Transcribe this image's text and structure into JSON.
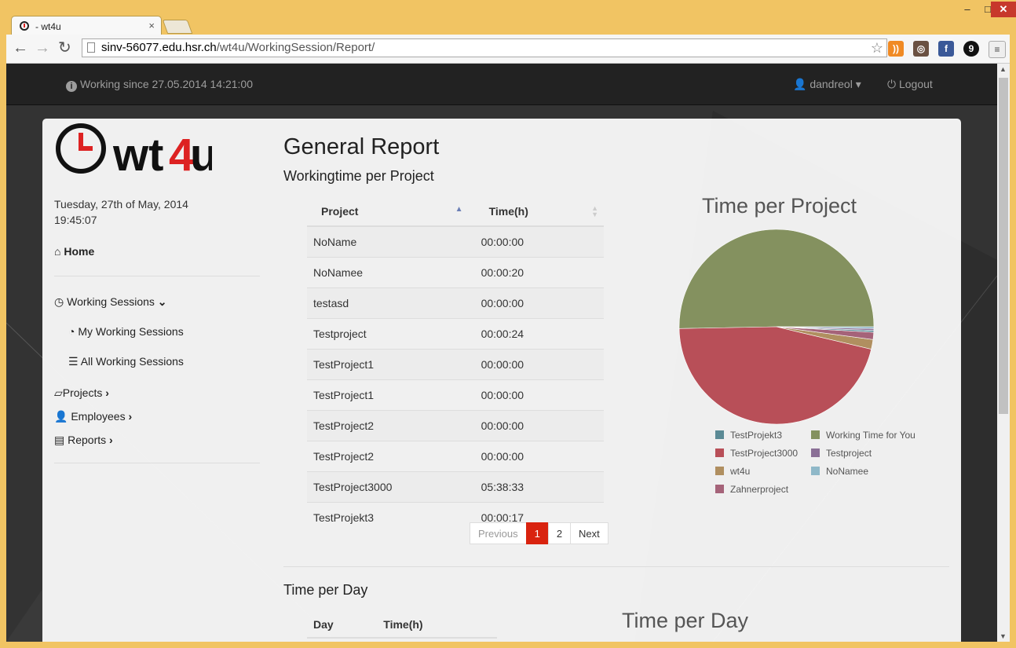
{
  "browser": {
    "tab_title": "- wt4u",
    "tab_close": "×",
    "url_host": "sinv-56077.edu.hsr.ch",
    "url_path": "/wt4u/WorkingSession/Report/",
    "window_controls": [
      "–",
      "□",
      "✕"
    ],
    "extensions": [
      "rss-icon",
      "instagram-icon",
      "facebook-icon",
      "nine-icon",
      "menu-icon"
    ]
  },
  "topnav": {
    "info_text": "Working since 27.05.2014 14:21:00",
    "user": "dandreol",
    "logout": "Logout"
  },
  "sidebar": {
    "logo_text_a": "wt",
    "logo_text_b": "4",
    "logo_text_c": "u",
    "date_line1": "Tuesday, 27th of May, 2014",
    "date_line2": "19:45:07",
    "home": "Home",
    "working_sessions": "Working Sessions",
    "my_working_sessions": "My Working Sessions",
    "all_working_sessions": "All Working Sessions",
    "projects": "Projects",
    "employees": "Employees",
    "reports": "Reports"
  },
  "main": {
    "title": "General Report",
    "section1": "Workingtime per Project",
    "section2": "Time per Day",
    "project_table": {
      "headers": [
        "Project",
        "Time(h)"
      ],
      "rows": [
        [
          "NoName",
          "00:00:00"
        ],
        [
          "NoNamee",
          "00:00:20"
        ],
        [
          "testasd",
          "00:00:00"
        ],
        [
          "Testproject",
          "00:00:24"
        ],
        [
          "TestProject1",
          "00:00:00"
        ],
        [
          "TestProject1",
          "00:00:00"
        ],
        [
          "TestProject2",
          "00:00:00"
        ],
        [
          "TestProject2",
          "00:00:00"
        ],
        [
          "TestProject3000",
          "05:38:33"
        ],
        [
          "TestProjekt3",
          "00:00:17"
        ]
      ]
    },
    "pager": {
      "previous": "Previous",
      "page1": "1",
      "page2": "2",
      "next": "Next"
    },
    "day_table": {
      "headers": [
        "Day",
        "Time(h)"
      ]
    }
  },
  "chart_data": {
    "type": "pie",
    "title": "Time per Project",
    "slices": [
      {
        "label": "Working Time for You",
        "value": 50.3,
        "color": "#84915f"
      },
      {
        "label": "TestProject3000",
        "value": 46.0,
        "color": "#b84f58"
      },
      {
        "label": "wt4u",
        "value": 1.6,
        "color": "#b08f60"
      },
      {
        "label": "Zahnerproject",
        "value": 1.2,
        "color": "#a56379"
      },
      {
        "label": "TestProjekt3",
        "value": 0.3,
        "color": "#5b8a95"
      },
      {
        "label": "Testproject",
        "value": 0.3,
        "color": "#8a6f96"
      },
      {
        "label": "NoNamee",
        "value": 0.3,
        "color": "#8fb8c8"
      }
    ],
    "legend": [
      {
        "label": "TestProjekt3",
        "color": "#5b8a95"
      },
      {
        "label": "Working Time for You",
        "color": "#84915f"
      },
      {
        "label": "TestProject3000",
        "color": "#b84f58"
      },
      {
        "label": "Testproject",
        "color": "#8a6f96"
      },
      {
        "label": "wt4u",
        "color": "#b08f60"
      },
      {
        "label": "NoNamee",
        "color": "#8fb8c8"
      },
      {
        "label": "Zahnerproject",
        "color": "#a56379"
      }
    ]
  },
  "chart2_title": "Time per Day"
}
